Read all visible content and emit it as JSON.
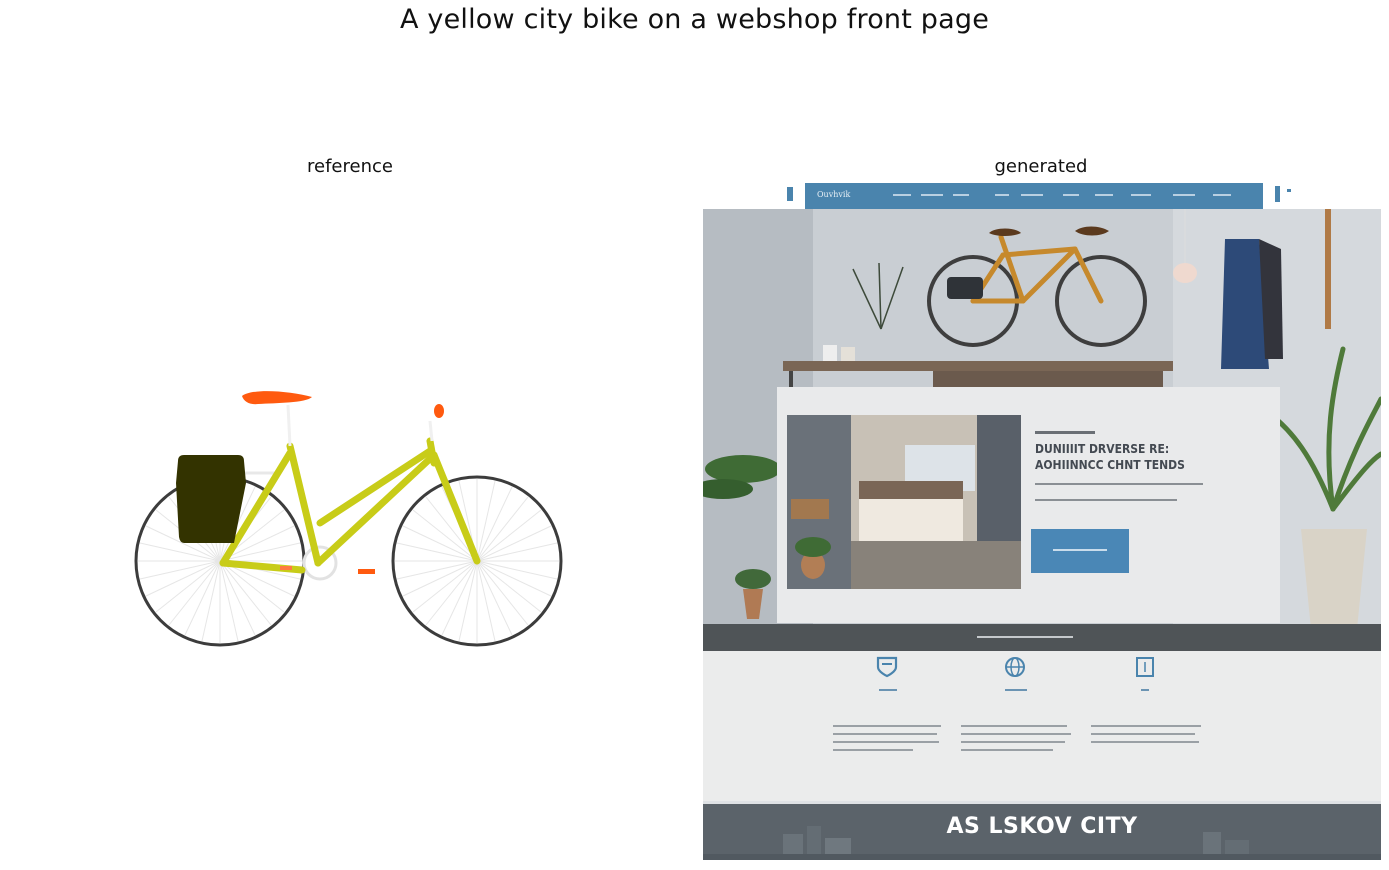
{
  "figure": {
    "title": "A yellow city bike on a webshop front page",
    "panels": [
      {
        "title": "reference"
      },
      {
        "title": "generated"
      }
    ]
  },
  "generated_page": {
    "nav_logo": "Ouvhvik",
    "hero_headline_line1": "DUNIIIIT DRVERSE RE:",
    "hero_headline_line2": "AOHIINNCC CHNT TENDS",
    "footer_title": "AS LSKOV CITY"
  },
  "colors": {
    "bike_frame": "#c8cc18",
    "saddle": "#ff5a0f",
    "pannier": "#333300",
    "nav_blue": "#4a84ad",
    "cta_blue": "#4a87b6",
    "footer_gray": "#5b636a"
  },
  "icons": [
    "shield-icon",
    "globe-icon",
    "book-icon"
  ]
}
